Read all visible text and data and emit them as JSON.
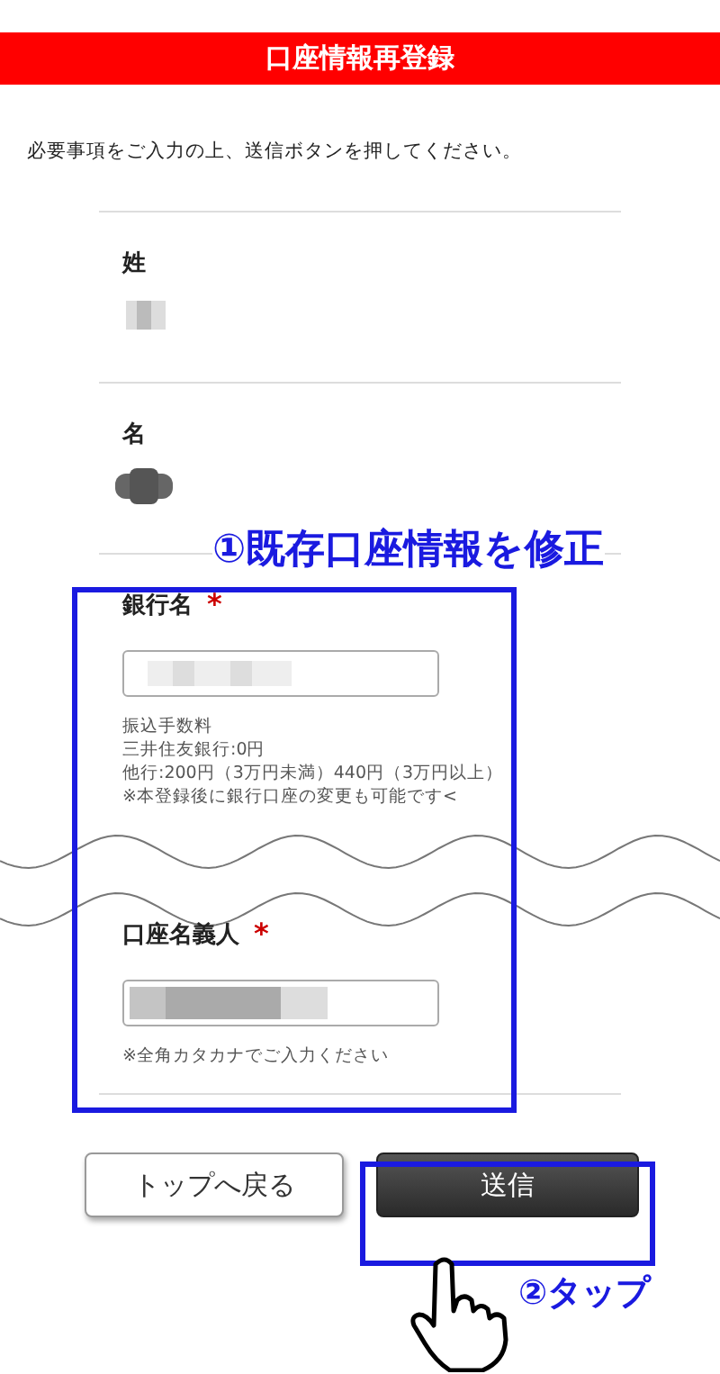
{
  "header": {
    "title": "口座情報再登録"
  },
  "intro": "必要事項をご入力の上、送信ボタンを押してください。",
  "fields": [
    {
      "kind": "display",
      "label": "姓"
    },
    {
      "kind": "display",
      "label": "名"
    },
    {
      "kind": "input",
      "label": "銀行名",
      "required_mark": "*",
      "notes": [
        "振込手数料",
        "三井住友銀行:0円",
        "他行:200円（3万円未満）440円（3万円以上）",
        "※本登録後に銀行口座の変更も可能です<"
      ]
    },
    {
      "kind": "input",
      "label": "口座名義人",
      "required_mark": "*",
      "notes": [
        "※全角カタカナでご入力ください"
      ]
    }
  ],
  "buttons": [
    {
      "kind": "secondary",
      "label": "トップへ戻る"
    },
    {
      "kind": "primary",
      "label": "送信"
    }
  ],
  "annotations": [
    {
      "kind": "box_label",
      "text": "①既存口座情報を修正"
    },
    {
      "kind": "tap",
      "text": "②タップ"
    }
  ]
}
